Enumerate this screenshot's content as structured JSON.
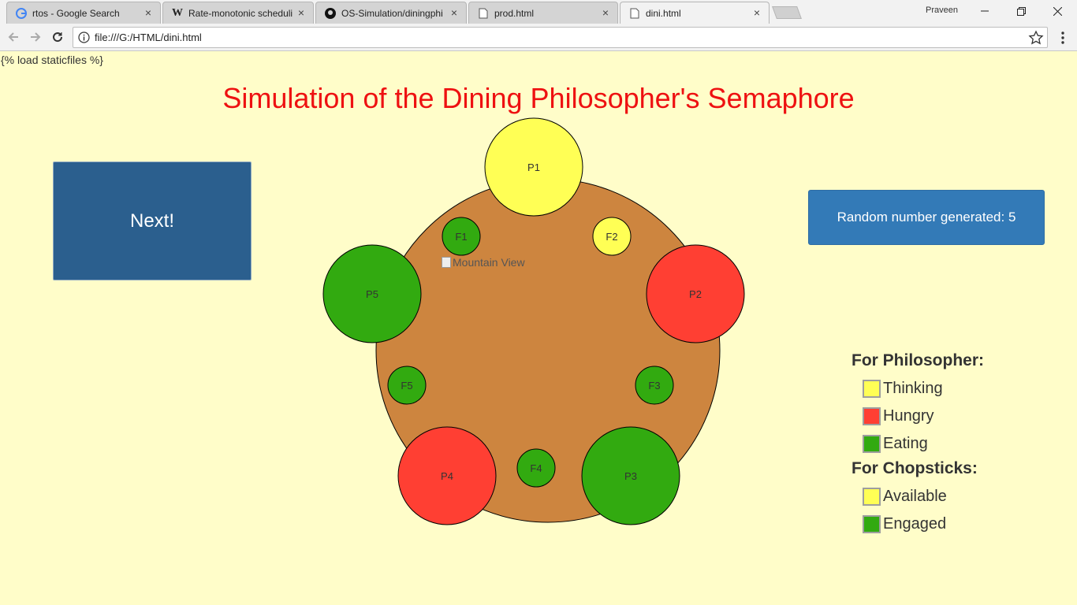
{
  "browser": {
    "tabs": [
      {
        "title": "rtos - Google Search",
        "icon": "google-icon",
        "active": false
      },
      {
        "title": "Rate-monotonic scheduli",
        "icon": "wikipedia-icon",
        "active": false
      },
      {
        "title": "OS-Simulation/diningphi",
        "icon": "github-icon",
        "active": false
      },
      {
        "title": "prod.html",
        "icon": "file-icon",
        "active": false
      },
      {
        "title": "dini.html",
        "icon": "file-icon",
        "active": true
      }
    ],
    "profile_name": "Praveen",
    "url": "file:///G:/HTML/dini.html"
  },
  "page": {
    "template_tag": "{% load staticfiles %}",
    "title": "Simulation of the Dining Philosopher's Semaphore",
    "next_label": "Next!",
    "random_label": "Random number generated: 5",
    "broken_image_alt": "Mountain View",
    "colors": {
      "table": "#cd853f",
      "thinking": "#ffff55",
      "hungry": "#ff3f33",
      "eating": "#32aa10",
      "available": "#ffff55",
      "engaged": "#32aa10"
    },
    "philosophers": [
      {
        "label": "P1",
        "state": "thinking"
      },
      {
        "label": "P2",
        "state": "hungry"
      },
      {
        "label": "P3",
        "state": "eating"
      },
      {
        "label": "P4",
        "state": "hungry"
      },
      {
        "label": "P5",
        "state": "eating"
      }
    ],
    "forks": [
      {
        "label": "F1",
        "state": "engaged"
      },
      {
        "label": "F2",
        "state": "available"
      },
      {
        "label": "F3",
        "state": "engaged"
      },
      {
        "label": "F4",
        "state": "engaged"
      },
      {
        "label": "F5",
        "state": "engaged"
      }
    ],
    "legend": {
      "philosopher_heading": "For Philosopher:",
      "philosopher_items": [
        {
          "label": "Thinking",
          "state": "thinking"
        },
        {
          "label": "Hungry",
          "state": "hungry"
        },
        {
          "label": "Eating",
          "state": "eating"
        }
      ],
      "chopstick_heading": "For Chopsticks:",
      "chopstick_items": [
        {
          "label": "Available",
          "state": "available"
        },
        {
          "label": "Engaged",
          "state": "engaged"
        }
      ]
    }
  }
}
